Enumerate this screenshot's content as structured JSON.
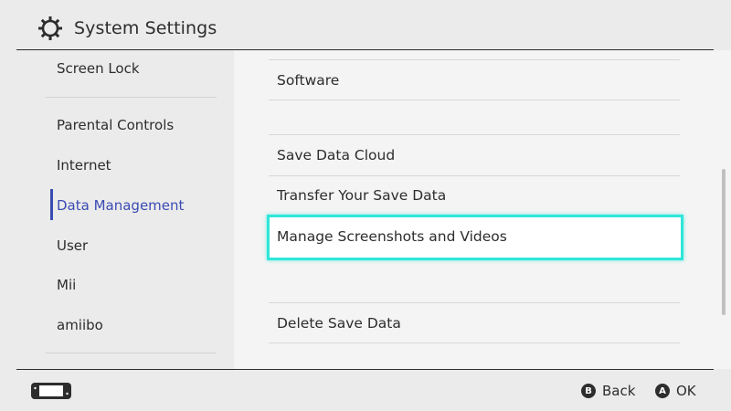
{
  "header": {
    "title": "System Settings",
    "icon": "gear-icon"
  },
  "sidebar": {
    "items": [
      {
        "label": "Screen Lock"
      },
      {
        "label": "Parental Controls"
      },
      {
        "label": "Internet"
      },
      {
        "label": "Data Management",
        "selected": true
      },
      {
        "label": "User"
      },
      {
        "label": "Mii"
      },
      {
        "label": "amiibo"
      }
    ],
    "accent_color": "#3a4bb3"
  },
  "content": {
    "rows": [
      {
        "label": "Software"
      },
      {
        "label": "Save Data Cloud"
      },
      {
        "label": "Transfer Your Save Data"
      },
      {
        "label": "Manage Screenshots and Videos",
        "focused": true
      },
      {
        "label": "Delete Save Data"
      }
    ],
    "focus_color": "#2ee6d8"
  },
  "footer": {
    "console_icon": "handheld-console-icon",
    "back": {
      "glyph": "B",
      "label": "Back"
    },
    "ok": {
      "glyph": "A",
      "label": "OK"
    }
  }
}
